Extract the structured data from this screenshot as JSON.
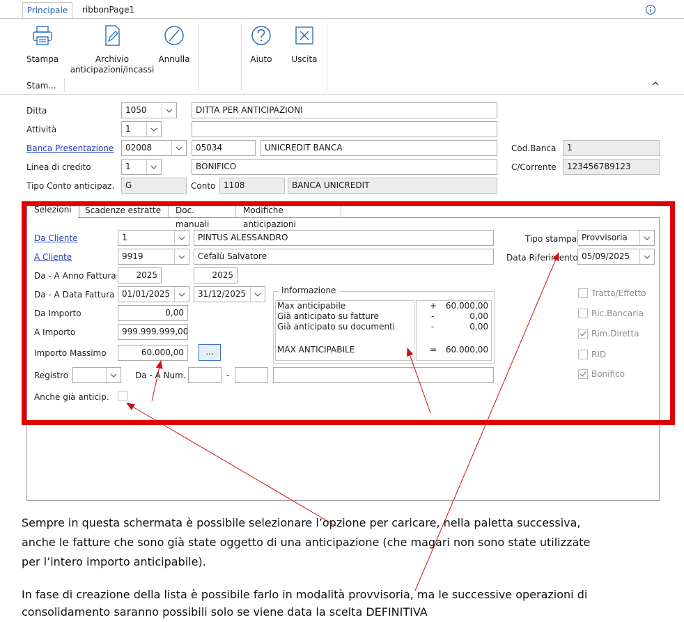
{
  "ribbon": {
    "tabs": [
      "Principale",
      "ribbonPage1"
    ],
    "buttons": {
      "stampa": "Stampa",
      "archivio_line1": "Archivio",
      "archivio_line2": "anticipazioni/incassi",
      "annulla": "Annulla",
      "aiuto": "Aiuto",
      "uscita": "Uscita"
    },
    "group_label": "Stam..."
  },
  "header_form": {
    "ditta": {
      "label": "Ditta",
      "code": "1050",
      "desc": "DITTA PER ANTICIPAZIONI"
    },
    "attivita": {
      "label": "Attività",
      "code": "1",
      "desc": ""
    },
    "banca": {
      "label": "Banca Presentazione",
      "abi": "02008",
      "cab": "05034",
      "desc": "UNICREDIT BANCA",
      "cod_label": "Cod.Banca",
      "cod_value": "1"
    },
    "linea": {
      "label": "Linea di credito",
      "code": "1",
      "desc": "BONIFICO",
      "cc_label": "C/Corrente",
      "cc_value": "123456789123"
    },
    "tipo_conto": {
      "label": "Tipo Conto anticipaz.",
      "value": "G",
      "conto_label": "Conto",
      "conto_value": "1108",
      "conto_desc": "BANCA UNICREDIT"
    }
  },
  "inner_tabs": [
    "Selezioni",
    "Scadenze estratte",
    "Doc. manuali",
    "Modifiche anticipazioni"
  ],
  "selezioni": {
    "da_cliente": {
      "label": "Da Cliente",
      "code": "1",
      "name": "PINTUS ALESSANDRO"
    },
    "a_cliente": {
      "label": "A Cliente",
      "code": "9919",
      "name": "Cefalù Salvatore"
    },
    "anno": {
      "label": "Da - A Anno Fattura",
      "from": "2025",
      "to": "2025"
    },
    "data": {
      "label": "Da - A Data Fattura",
      "from": "01/01/2025",
      "to": "31/12/2025"
    },
    "da_importo": {
      "label": "Da Importo",
      "value": "0,00"
    },
    "a_importo": {
      "label": "A Importo",
      "value": "999.999.999,00"
    },
    "importo_max": {
      "label": "Importo Massimo",
      "value": "60.000,00",
      "button": "..."
    },
    "registro": {
      "label": "Registro",
      "value": "",
      "num_label": "Da - A Num.",
      "dash": "-"
    },
    "anche": {
      "label": "Anche già anticip."
    },
    "tipo_stampa": {
      "label": "Tipo stampa",
      "value": "Provvisoria"
    },
    "data_rif": {
      "label": "Data Riferimento",
      "value": "05/09/2025"
    },
    "informazione": {
      "title": "Informazione",
      "rows": [
        "Max anticipabile",
        "Già anticipato su fatture",
        "Già anticipato su documenti"
      ],
      "total": "MAX ANTICIPABILE",
      "signs": [
        "+",
        "-",
        "-"
      ],
      "values": [
        "60.000,00",
        "0,00",
        "0,00"
      ],
      "total_sign": "=",
      "total_value": "60.000,00"
    },
    "checks": [
      {
        "label": "Tratta/Effetto",
        "checked": false
      },
      {
        "label": "Ric.Bancaria",
        "checked": false
      },
      {
        "label": "Rim.Diretta",
        "checked": true
      },
      {
        "label": "RID",
        "checked": false
      },
      {
        "label": "Bonifico",
        "checked": true
      }
    ]
  },
  "captions": {
    "p1_l1": "Sempre in questa schermata è possibile selezionare l’opzione per caricare, nella paletta successiva,",
    "p1_l2": "anche le fatture che sono già state oggetto di una anticipazione (che magari non sono state utilizzate",
    "p1_l3": "per l’intero importo anticipabile).",
    "p2_l1": "In fase di creazione della lista è possibile farlo in modalità provvisoria, ma le successive operazioni di",
    "p2_l2": "consolidamento saranno possibili solo se viene data la scelta DEFINITIVA"
  },
  "colors": {
    "highlight": "#e00000",
    "link": "#1f3fb8",
    "arrow": "#d01010"
  }
}
